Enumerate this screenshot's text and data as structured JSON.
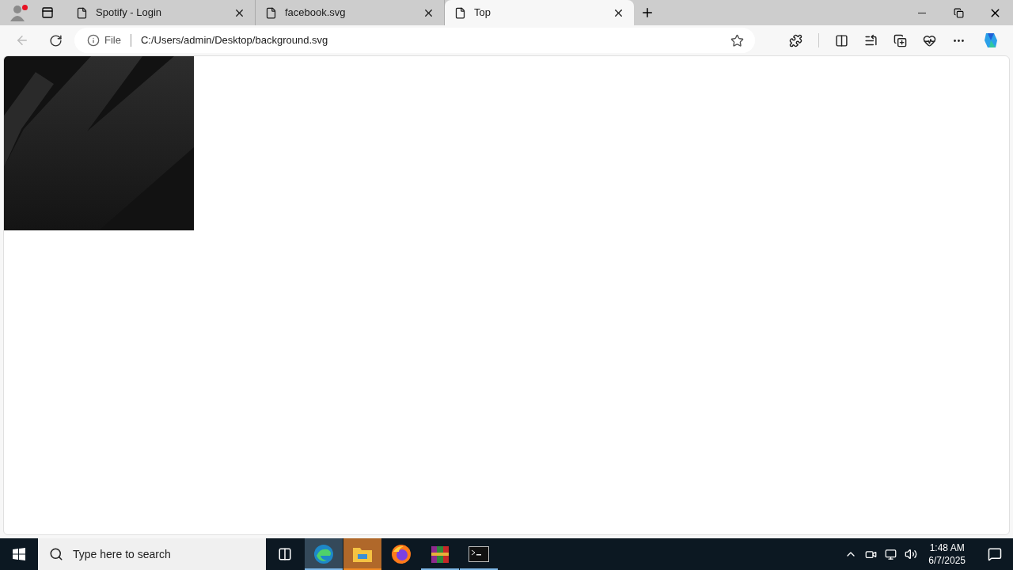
{
  "browser": {
    "tabs": [
      {
        "title": "Spotify - Login",
        "selected": false
      },
      {
        "title": "facebook.svg",
        "selected": false
      },
      {
        "title": "Top",
        "selected": true
      }
    ],
    "address_bar": {
      "scheme_label": "File",
      "url": "C:/Users/admin/Desktop/background.svg"
    },
    "profile_notification": true
  },
  "taskbar": {
    "search_placeholder": "Type here to search",
    "apps": [
      {
        "kind": "edge",
        "running": true,
        "selected": true,
        "attention": false
      },
      {
        "kind": "explorer",
        "running": true,
        "selected": false,
        "attention": true
      },
      {
        "kind": "firefox",
        "running": false,
        "selected": false,
        "attention": false
      },
      {
        "kind": "winrar",
        "running": true,
        "selected": false,
        "attention": false
      },
      {
        "kind": "terminal",
        "running": true,
        "selected": false,
        "attention": false
      }
    ],
    "time": "1:48 AM",
    "date": "6/7/2025"
  }
}
